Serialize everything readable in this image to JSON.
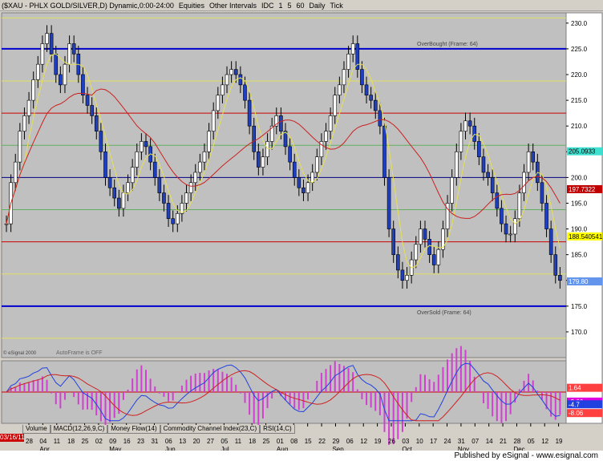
{
  "toolbar": {
    "symbol": "($XAU - PHLX GOLD/SILVER,D) Dynamic,0:00-24:00",
    "equities": "Equities",
    "other_intervals": "Other Intervals",
    "idc": "IDC",
    "i1": "1",
    "i5": "5",
    "i60": "60",
    "daily": "Daily",
    "tick": "Tick"
  },
  "chart_data": {
    "type": "candlestick",
    "ylim": [
      165,
      232
    ],
    "y_ticks": [
      170,
      175,
      180,
      185,
      190,
      195,
      200,
      205,
      210,
      215,
      220,
      225,
      230
    ],
    "x_ticks": [
      "28",
      "04",
      "11",
      "18",
      "25",
      "02",
      "09",
      "16",
      "23",
      "31",
      "06",
      "13",
      "20",
      "27",
      "05",
      "11",
      "18",
      "25",
      "01",
      "08",
      "15",
      "22",
      "29",
      "06",
      "12",
      "19",
      "26",
      "03",
      "10",
      "17",
      "24",
      "31",
      "07",
      "14",
      "21",
      "28",
      "05",
      "12",
      "19"
    ],
    "x_month_labels": [
      "Apr",
      "May",
      "Jun",
      "Jul",
      "Aug",
      "Sep",
      "Oct",
      "Nov",
      "Dec"
    ],
    "annotations": {
      "overbought": "OverBought (Frame: 64)",
      "oversold": "OverSold (Frame: 64)",
      "autoframe": "AutoFrame is OFF",
      "copyright": "© eSignal 2000"
    },
    "price_tags": [
      {
        "label": "205.0933",
        "value": 205.09,
        "color": "#40e0d0"
      },
      {
        "label": "197.7322",
        "value": 197.73,
        "color": "#c00000"
      },
      {
        "label": "188.540541",
        "value": 188.54,
        "color": "#ffff00"
      },
      {
        "label": "179.80",
        "value": 179.8,
        "color": "#6495ed"
      }
    ],
    "horizontal_levels": [
      {
        "value": 231.0,
        "color": "#e0e060"
      },
      {
        "value": 225.0,
        "color": "#0000cc"
      },
      {
        "value": 218.75,
        "color": "#e0e060"
      },
      {
        "value": 212.5,
        "color": "#cc0000"
      },
      {
        "value": 206.25,
        "color": "#60b060"
      },
      {
        "value": 200.0,
        "color": "#000080"
      },
      {
        "value": 193.75,
        "color": "#60b060"
      },
      {
        "value": 187.5,
        "color": "#cc0000"
      },
      {
        "value": 181.25,
        "color": "#e0e060"
      },
      {
        "value": 175.0,
        "color": "#0000cc"
      },
      {
        "value": 168.75,
        "color": "#e0e060"
      }
    ],
    "close": [
      191,
      199,
      203,
      209,
      212,
      215,
      219,
      222,
      226,
      228,
      224,
      220,
      218,
      222,
      226,
      224,
      220,
      216,
      214,
      212,
      209,
      205,
      200,
      198,
      196,
      194,
      197,
      199,
      202,
      205,
      207,
      206,
      203,
      200,
      197,
      195,
      192,
      191,
      193,
      195,
      197,
      199,
      201,
      203,
      205,
      209,
      213,
      216,
      218,
      220,
      221,
      220,
      218,
      215,
      210,
      205,
      202,
      204,
      207,
      210,
      212,
      209,
      206,
      203,
      200,
      198,
      197,
      199,
      201,
      204,
      207,
      209,
      212,
      216,
      218,
      221,
      224,
      226,
      221,
      218,
      216,
      215,
      213,
      210,
      200,
      190,
      185,
      182,
      180,
      181,
      184,
      187,
      190,
      188,
      185,
      183,
      186,
      190,
      195,
      200,
      205,
      209,
      211,
      210,
      207,
      204,
      201,
      200,
      197,
      194,
      191,
      189,
      189,
      192,
      197,
      201,
      205,
      203,
      199,
      195,
      190,
      185,
      181,
      180
    ],
    "sub_panel": {
      "labels": [
        "1.64",
        "-3.66",
        "-4.7",
        "-8.06"
      ],
      "ylim": [
        -12,
        12
      ]
    },
    "date_badge": "03/16/11"
  },
  "tabs": [
    "Volume",
    "MACD(12,26,9,C)",
    "Money Flow(14)",
    "Commodity Channel Index(23,C)",
    "RSI(14,C)"
  ],
  "footer": "Published by eSignal - www.esignal.com"
}
